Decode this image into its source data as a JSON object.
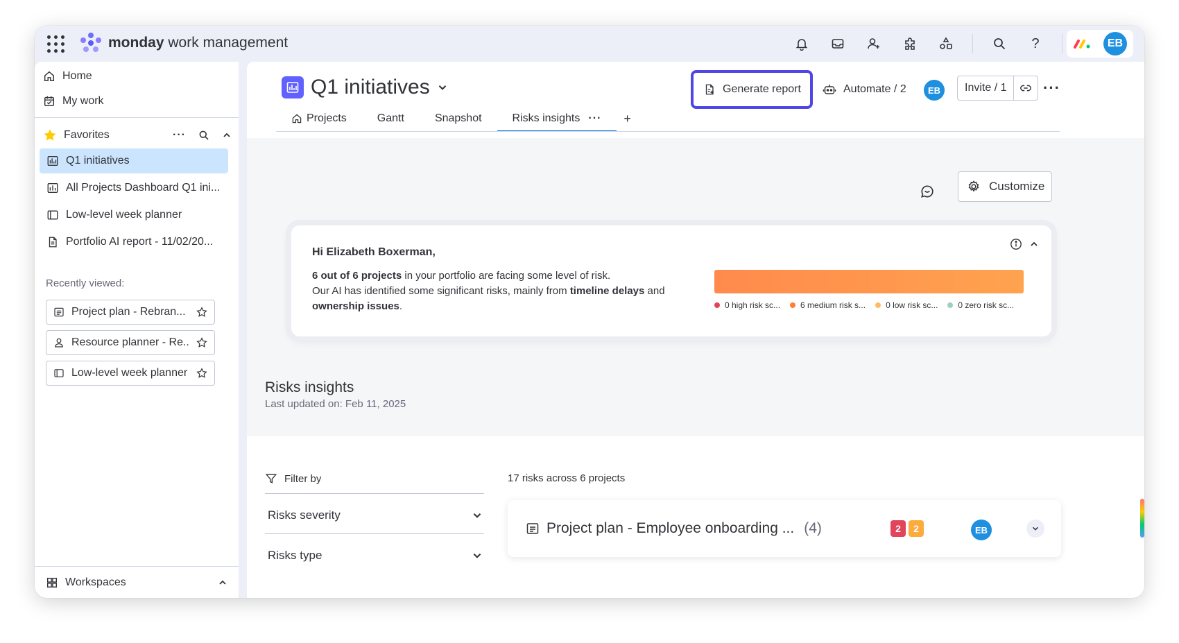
{
  "topbar": {
    "brand_bold": "monday",
    "brand_rest": " work management",
    "avatar_initials": "EB",
    "icons": [
      "bell-icon",
      "inbox-icon",
      "invite-user-icon",
      "apps-icon",
      "integrations-icon",
      "search-icon",
      "help-icon"
    ]
  },
  "sidebar": {
    "home": "Home",
    "my_work": "My work",
    "favorites": "Favorites",
    "boards": [
      {
        "label": "Q1 initiatives",
        "icon": "dashboard-icon"
      },
      {
        "label": "All Projects Dashboard Q1 ini...",
        "icon": "chart-icon"
      },
      {
        "label": "Low-level week planner",
        "icon": "board-icon"
      },
      {
        "label": "Portfolio AI report - 11/02/20...",
        "icon": "doc-icon"
      }
    ],
    "recently_viewed_label": "Recently viewed:",
    "recent": [
      {
        "label": "Project plan - Rebran..."
      },
      {
        "label": "Resource planner - Re..."
      },
      {
        "label": "Low-level week planner"
      }
    ],
    "workspaces": "Workspaces"
  },
  "board": {
    "title": "Q1 initiatives",
    "generate_report": "Generate report",
    "automate": "Automate / 2",
    "avatar_initials": "EB",
    "invite": "Invite / 1",
    "tabs": [
      {
        "label": "Projects"
      },
      {
        "label": "Gantt"
      },
      {
        "label": "Snapshot"
      },
      {
        "label": "Risks insights"
      }
    ],
    "active_tab": "Risks insights"
  },
  "toolbar": {
    "customize": "Customize"
  },
  "insight": {
    "greeting": "Hi Elizabeth Boxerman,",
    "line1_bold": "6 out of 6 projects",
    "line1_rest": " in your portfolio are facing some level of risk.",
    "line2_pre": "Our AI has identified some significant risks, mainly from ",
    "line2_bold1": "timeline delays",
    "line2_mid": " and ",
    "line2_bold2": "ownership issues",
    "line2_end": ".",
    "legend": [
      {
        "label": "0 high risk sc...",
        "color": "#e2445c"
      },
      {
        "label": "6 medium risk s...",
        "color": "#ff7f32"
      },
      {
        "label": "0 low risk sc...",
        "color": "#fdbc64"
      },
      {
        "label": "0 zero risk sc...",
        "color": "#9cd3b8"
      }
    ],
    "bar_fill_color": "#ff9147"
  },
  "risks": {
    "title": "Risks insights",
    "updated": "Last updated on: Feb 11, 2025",
    "filter_by": "Filter by",
    "filters": [
      {
        "label": "Risks severity"
      },
      {
        "label": "Risks type"
      }
    ],
    "count_text": "17 risks across 6 projects",
    "projects": [
      {
        "name": "Project plan - Employee onboarding ...",
        "count": "(4)",
        "badge_high": "2",
        "badge_medium": "2",
        "avatar": "EB"
      }
    ]
  }
}
